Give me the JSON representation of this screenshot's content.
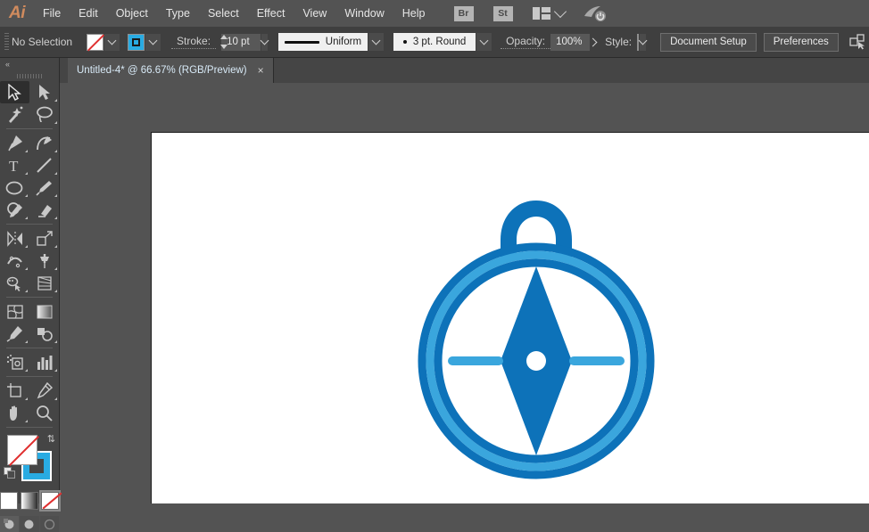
{
  "app": {
    "name": "Adobe Illustrator",
    "logo_text": "Ai"
  },
  "menubar": {
    "items": [
      {
        "label": "File"
      },
      {
        "label": "Edit"
      },
      {
        "label": "Object"
      },
      {
        "label": "Type"
      },
      {
        "label": "Select"
      },
      {
        "label": "Effect"
      },
      {
        "label": "View"
      },
      {
        "label": "Window"
      },
      {
        "label": "Help"
      }
    ],
    "bridge_button": "Br",
    "stock_button": "St",
    "arrange_icon": "arrange-documents-icon",
    "arrange_chevron": "chevron-down-icon",
    "sync_icon": "cloud-sync-icon"
  },
  "controlbar": {
    "selection_status": "No Selection",
    "fill_swatch": {
      "name": "fill-none",
      "color": "#ffffff",
      "slash": "#e03030"
    },
    "stroke_swatch": {
      "name": "stroke-cyan",
      "color": "#29abe2"
    },
    "stroke_label": "Stroke:",
    "stroke_weight": "10 pt",
    "stroke_profile": "Uniform",
    "brush_definition": "3 pt. Round",
    "opacity_label": "Opacity:",
    "opacity_value": "100%",
    "style_label": "Style:",
    "style_swatch_color": "#d8d8d8",
    "document_setup_button": "Document Setup",
    "preferences_button": "Preferences",
    "select_similar_icon": "select-similar-icon"
  },
  "tabbar": {
    "tabs": [
      {
        "title": "Untitled-4* @ 66.67% (RGB/Preview)",
        "close": "×",
        "active": true
      }
    ]
  },
  "toolbar": {
    "collapse_label": "«",
    "tools": [
      {
        "name": "selection-tool",
        "active": true
      },
      {
        "name": "direct-selection-tool",
        "active": false
      },
      {
        "name": "magic-wand-tool",
        "active": false
      },
      {
        "name": "lasso-tool",
        "active": false
      },
      {
        "name": "pen-tool",
        "active": false
      },
      {
        "name": "curvature-tool",
        "active": false
      },
      {
        "name": "type-tool",
        "active": false
      },
      {
        "name": "line-segment-tool",
        "active": false
      },
      {
        "name": "ellipse-tool",
        "active": false
      },
      {
        "name": "paintbrush-tool",
        "active": false
      },
      {
        "name": "shaper-tool",
        "active": false
      },
      {
        "name": "eraser-tool",
        "active": false
      },
      {
        "name": "rotate-tool",
        "active": false
      },
      {
        "name": "scale-tool",
        "active": false
      },
      {
        "name": "width-tool",
        "active": false
      },
      {
        "name": "free-transform-tool",
        "active": false
      },
      {
        "name": "shape-builder-tool",
        "active": false
      },
      {
        "name": "perspective-grid-tool",
        "active": false
      },
      {
        "name": "mesh-tool",
        "active": false
      },
      {
        "name": "gradient-tool",
        "active": false
      },
      {
        "name": "eyedropper-tool",
        "active": false
      },
      {
        "name": "blend-tool",
        "active": false
      },
      {
        "name": "symbol-sprayer-tool",
        "active": false
      },
      {
        "name": "column-graph-tool",
        "active": false
      },
      {
        "name": "artboard-tool",
        "active": false
      },
      {
        "name": "slice-tool",
        "active": false
      },
      {
        "name": "hand-tool",
        "active": false
      },
      {
        "name": "zoom-tool",
        "active": false
      }
    ],
    "fill_color": "#ffffff",
    "fill_is_none": true,
    "stroke_color": "#29abe2",
    "color_modes": [
      {
        "name": "color-mode-button",
        "selected": false
      },
      {
        "name": "gradient-mode-button",
        "selected": false
      },
      {
        "name": "none-mode-button",
        "selected": true
      }
    ],
    "drawing_modes": [
      {
        "name": "draw-normal-button",
        "selected": true
      },
      {
        "name": "draw-behind-button",
        "selected": false
      },
      {
        "name": "draw-inside-button",
        "selected": false
      }
    ]
  },
  "canvas": {
    "background": "#535353",
    "artboard_color": "#ffffff",
    "artwork": {
      "name": "compass-illustration",
      "colors": {
        "dark_blue": "#0d72b9",
        "light_blue": "#3aa6dd",
        "white": "#ffffff"
      },
      "parts": [
        {
          "name": "compass-loop"
        },
        {
          "name": "compass-outer-ring"
        },
        {
          "name": "compass-inner-ring"
        },
        {
          "name": "compass-needle"
        },
        {
          "name": "compass-center-dot"
        },
        {
          "name": "compass-tick-left"
        },
        {
          "name": "compass-tick-right"
        }
      ]
    }
  }
}
